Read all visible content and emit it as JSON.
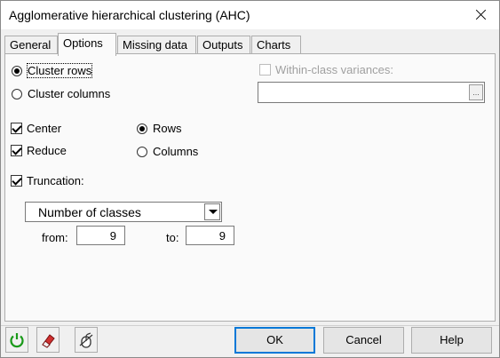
{
  "window": {
    "title": "Agglomerative hierarchical clustering (AHC)"
  },
  "tabs": [
    {
      "label": "General"
    },
    {
      "label": "Options"
    },
    {
      "label": "Missing data"
    },
    {
      "label": "Outputs"
    },
    {
      "label": "Charts"
    }
  ],
  "active_tab": "Options",
  "options": {
    "cluster_rows": {
      "label": "Cluster rows",
      "selected": true
    },
    "cluster_columns": {
      "label": "Cluster columns",
      "selected": false
    },
    "center": {
      "label": "Center",
      "checked": true
    },
    "reduce": {
      "label": "Reduce",
      "checked": true
    },
    "rows": {
      "label": "Rows",
      "selected": true
    },
    "columns": {
      "label": "Columns",
      "selected": false
    },
    "truncation": {
      "label": "Truncation:",
      "checked": true
    },
    "truncation_mode": {
      "value": "Number of classes"
    },
    "from": {
      "label": "from:",
      "value": "9"
    },
    "to": {
      "label": "to:",
      "value": "9"
    },
    "within_class_variances": {
      "label": "Within-class variances:",
      "checked": false,
      "enabled": false
    },
    "browse_label": "..."
  },
  "buttons": {
    "ok": "OK",
    "cancel": "Cancel",
    "help": "Help"
  },
  "icons": {
    "reset": "reset-icon",
    "eraser": "eraser-icon",
    "mouse": "mouse-icon"
  },
  "colors": {
    "dialog_bg": "#f0f0f0",
    "panel_bg": "#fafafa",
    "default_button_border": "#0078d7",
    "reset_icon_green": "#1a9a1a",
    "eraser_red": "#d03030"
  }
}
